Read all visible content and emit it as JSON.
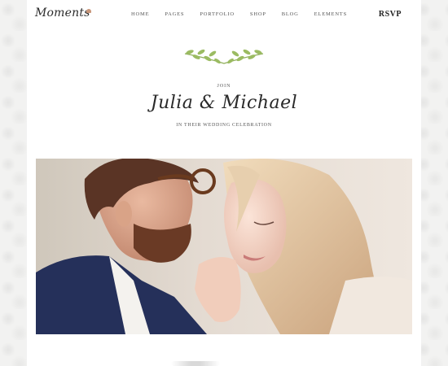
{
  "brand": {
    "logo_text": "Moments"
  },
  "nav": {
    "items": [
      "HOME",
      "PAGES",
      "PORTFOLIO",
      "SHOP",
      "BLOG",
      "ELEMENTS"
    ],
    "cta_label": "RSVP"
  },
  "invitation": {
    "join_text": "JOIN",
    "couple_names": "Julia & Michael",
    "subtitle": "IN THEIR WEDDING CELEBRATION"
  },
  "colors": {
    "page_bg": "#ffffff",
    "outer_bg": "#f2f2f1",
    "leaf_green": "#8fae5a",
    "logo_heart": "#c8967a"
  },
  "hero": {
    "icon": "couple-photo"
  }
}
